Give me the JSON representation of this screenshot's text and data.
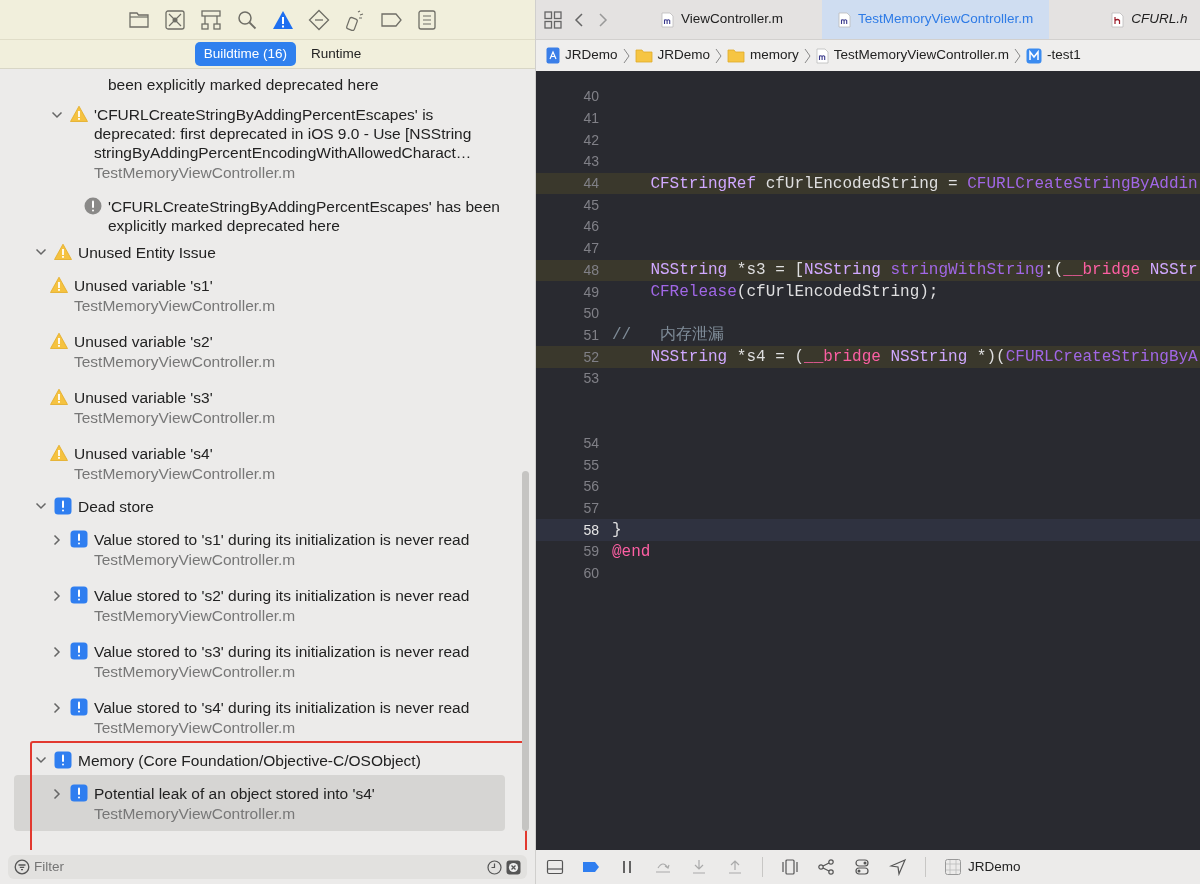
{
  "navigator": {
    "tools": [
      {
        "kind": "folder",
        "selected": false
      },
      {
        "kind": "source-control",
        "selected": false
      },
      {
        "kind": "hierarchy",
        "selected": false
      },
      {
        "kind": "search",
        "selected": false
      },
      {
        "kind": "issue",
        "selected": true
      },
      {
        "kind": "test",
        "selected": false
      },
      {
        "kind": "debug",
        "selected": false
      },
      {
        "kind": "breakpoint",
        "selected": false
      },
      {
        "kind": "report",
        "selected": false
      }
    ],
    "segments": [
      {
        "label": "Buildtime (16)",
        "selected": true
      },
      {
        "label": "Runtime",
        "selected": false
      }
    ],
    "issues": [
      {
        "kind": "note-tail",
        "text": "been explicitly marked deprecated here",
        "selected": false
      },
      {
        "kind": "warning",
        "expanded": true,
        "selected": false,
        "text": "'CFURLCreateStringByAddingPercentEscapes' is deprecated: first deprecated in iOS 9.0 - Use [NSString stringByAddingPercentEncodingWithAllowedCharact…",
        "file": "TestMemoryViewController.m",
        "children": [
          {
            "kind": "note",
            "text": "'CFURLCreateStringByAddingPercentEscapes' has been explicitly marked deprecated here",
            "selected": false
          }
        ]
      },
      {
        "kind": "warning-group",
        "expanded": true,
        "highlighted": false,
        "title": "Unused Entity Issue",
        "children": [
          {
            "kind": "warning",
            "selected": false,
            "text": "Unused variable 's1'",
            "file": "TestMemoryViewController.m"
          },
          {
            "kind": "warning",
            "selected": false,
            "text": "Unused variable 's2'",
            "file": "TestMemoryViewController.m"
          },
          {
            "kind": "warning",
            "selected": false,
            "text": "Unused variable 's3'",
            "file": "TestMemoryViewController.m"
          },
          {
            "kind": "warning",
            "selected": false,
            "text": "Unused variable 's4'",
            "file": "TestMemoryViewController.m"
          }
        ]
      },
      {
        "kind": "analyzer-group",
        "expanded": true,
        "highlighted": false,
        "title": "Dead store",
        "children": [
          {
            "kind": "analyzer",
            "expanded": false,
            "selected": false,
            "text": "Value stored to 's1' during its initialization is never read",
            "file": "TestMemoryViewController.m"
          },
          {
            "kind": "analyzer",
            "expanded": false,
            "selected": false,
            "text": "Value stored to 's2' during its initialization is never read",
            "file": "TestMemoryViewController.m"
          },
          {
            "kind": "analyzer",
            "expanded": false,
            "selected": false,
            "text": "Value stored to 's3' during its initialization is never read",
            "file": "TestMemoryViewController.m"
          },
          {
            "kind": "analyzer",
            "expanded": false,
            "selected": false,
            "text": "Value stored to 's4' during its initialization is never read",
            "file": "TestMemoryViewController.m"
          }
        ]
      },
      {
        "kind": "analyzer-group",
        "expanded": true,
        "highlighted": true,
        "title": "Memory (Core Foundation/Objective-C/OSObject)",
        "children": [
          {
            "kind": "analyzer",
            "expanded": false,
            "selected": true,
            "text": "Potential leak of an object stored into 's4'",
            "file": "TestMemoryViewController.m"
          }
        ]
      }
    ],
    "filter": {
      "placeholder": "Filter"
    }
  },
  "editor": {
    "tabs": [
      {
        "kind": "m",
        "label": "ViewController.m",
        "selected": false,
        "italic": false
      },
      {
        "kind": "m",
        "label": "TestMemoryViewController.m",
        "selected": true,
        "italic": false
      },
      {
        "kind": "h",
        "label": "CFURL.h",
        "selected": false,
        "italic": true
      }
    ],
    "breadcrumb": [
      {
        "kind": "project",
        "label": "JRDemo"
      },
      {
        "kind": "folder",
        "label": "JRDemo"
      },
      {
        "kind": "folder",
        "label": "memory"
      },
      {
        "kind": "m",
        "label": "TestMemoryViewController.m"
      },
      {
        "kind": "method",
        "label": "-test1"
      }
    ],
    "lines": [
      {
        "number": "40",
        "warning": false,
        "current": false
      },
      {
        "number": "41",
        "warning": false,
        "current": false
      },
      {
        "number": "42",
        "warning": false,
        "current": false
      },
      {
        "number": "43",
        "warning": false,
        "current": false
      },
      {
        "number": "44",
        "warning": true,
        "current": false,
        "indented": true,
        "tokens": [
          {
            "kind": "type",
            "text": "CFStringRef"
          },
          {
            "kind": "plain",
            "text": " cfUrlEncodedString = "
          },
          {
            "kind": "func",
            "text": "CFURLCreateStringByAddin"
          }
        ]
      },
      {
        "number": "45",
        "warning": false,
        "current": false
      },
      {
        "number": "46",
        "warning": false,
        "current": false
      },
      {
        "number": "47",
        "warning": false,
        "current": false
      },
      {
        "number": "48",
        "warning": true,
        "current": false,
        "indented": true,
        "tokens": [
          {
            "kind": "type",
            "text": "NSString"
          },
          {
            "kind": "plain",
            "text": " *s3 = ["
          },
          {
            "kind": "type",
            "text": "NSString "
          },
          {
            "kind": "func",
            "text": "stringWithString"
          },
          {
            "kind": "plain",
            "text": ":("
          },
          {
            "kind": "keyword",
            "text": "__bridge "
          },
          {
            "kind": "type",
            "text": "NSStr"
          }
        ]
      },
      {
        "number": "49",
        "warning": false,
        "current": false,
        "indented": true,
        "tokens": [
          {
            "kind": "func",
            "text": "CFRelease"
          },
          {
            "kind": "plain",
            "text": "(cfUrlEncodedString);"
          }
        ]
      },
      {
        "number": "50",
        "warning": false,
        "current": false
      },
      {
        "number": "51",
        "warning": false,
        "current": false,
        "indented": false,
        "tokens": [
          {
            "kind": "comment",
            "text": "//   内存泄漏"
          }
        ]
      },
      {
        "number": "52",
        "warning": true,
        "current": false,
        "indented": true,
        "tokens": [
          {
            "kind": "type",
            "text": "NSString"
          },
          {
            "kind": "plain",
            "text": " *s4 = ("
          },
          {
            "kind": "keyword",
            "text": "__bridge "
          },
          {
            "kind": "type",
            "text": "NSString"
          },
          {
            "kind": "plain",
            "text": " *)("
          },
          {
            "kind": "func",
            "text": "CFURLCreateStringByA"
          }
        ]
      },
      {
        "number": "53",
        "warning": false,
        "current": false
      },
      {
        "warning": false,
        "current": false
      },
      {
        "number": "54",
        "warning": false,
        "current": false
      },
      {
        "number": "55",
        "warning": false,
        "current": false
      },
      {
        "number": "56",
        "warning": false,
        "current": false
      },
      {
        "number": "57",
        "warning": false,
        "current": false
      },
      {
        "number": "58",
        "warning": false,
        "current": true,
        "indented": false,
        "tokens": [
          {
            "kind": "plain",
            "text": "}"
          }
        ]
      },
      {
        "number": "59",
        "warning": false,
        "current": false,
        "indented": false,
        "tokens": [
          {
            "kind": "keyword",
            "text": "@end"
          }
        ]
      },
      {
        "number": "60",
        "warning": false,
        "current": false
      }
    ],
    "scheme": "JRDemo"
  }
}
